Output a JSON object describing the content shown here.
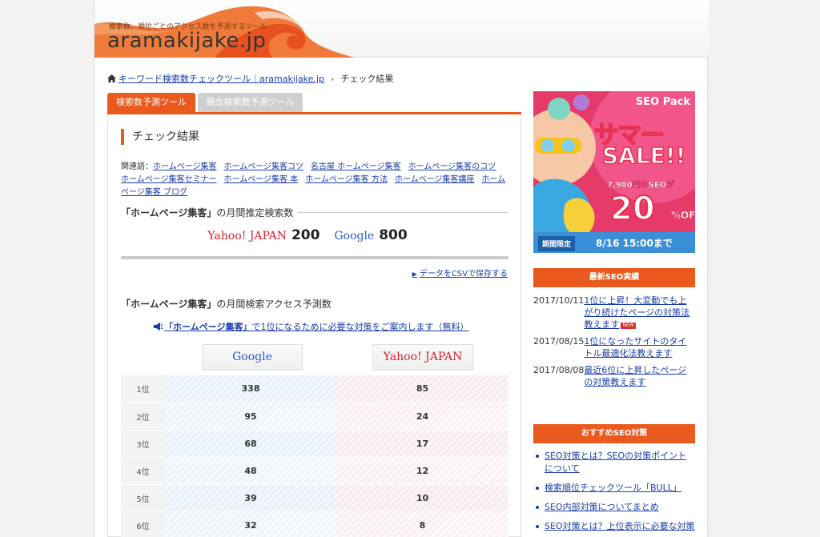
{
  "header": {
    "tagline": "検索数、順位ごとのアクセス数を予測するツール",
    "logo": "aramakijake.jp"
  },
  "breadcrumb": {
    "home_link": "キーワード検索数チェックツール｜aramakijake.jp",
    "current": "チェック結果"
  },
  "tabs": [
    {
      "label": "検索数予測ツール",
      "active": true
    },
    {
      "label": "競合検索数予測ツール",
      "active": false
    }
  ],
  "main": {
    "title": "チェック結果",
    "related_label": "関連語：",
    "related": [
      "ホームページ集客",
      "ホームページ集客コツ",
      "名古屋 ホームページ集客",
      "ホームページ集客のコツ",
      "ホームページ集客セミナー",
      "ホームページ集客 本",
      "ホームページ集客 方法",
      "ホームページ集客講座",
      "ホームページ集客 ブログ"
    ],
    "volume_heading_keyword": "「ホームページ集客」",
    "volume_heading_suffix": "の月間推定検索数",
    "yahoo_label": "Yahoo! JAPAN",
    "yahoo_volume": "200",
    "google_label": "Google",
    "google_volume": "800",
    "csv_link": "データをCSVで保存する",
    "access_heading_keyword": "「ホームページ集客」",
    "access_heading_suffix": "の月間検索アクセス予測数",
    "cta_keyword": "「ホームページ集客」",
    "cta_suffix": "で1位になるために必要な対策をご案内します（無料）",
    "col_google": "Google",
    "col_yahoo": "Yahoo! JAPAN",
    "ranks": [
      {
        "rank": "1位",
        "google": "338",
        "yahoo": "85"
      },
      {
        "rank": "2位",
        "google": "95",
        "yahoo": "24"
      },
      {
        "rank": "3位",
        "google": "68",
        "yahoo": "17"
      },
      {
        "rank": "4位",
        "google": "48",
        "yahoo": "12"
      },
      {
        "rank": "5位",
        "google": "39",
        "yahoo": "10"
      },
      {
        "rank": "6位",
        "google": "32",
        "yahoo": "8"
      }
    ]
  },
  "banner": {
    "seo_pack": "SEO Pack",
    "summer": "サマー",
    "sale": "SALE!!",
    "price": "7,980円のSEOが",
    "percent": "20",
    "off": "%OFF",
    "limited": "期間限定",
    "date": "8/16 15:00まで"
  },
  "sidebar": {
    "news_heading": "最新SEO実績",
    "news": [
      {
        "date": "2017/10/11",
        "title": "1位に上昇！大変動でも上がり続けたページの対策法教えます",
        "new_badge": "NEW"
      },
      {
        "date": "2017/08/15",
        "title": "1位になったサイトのタイトル最適化法教えます",
        "new_badge": ""
      },
      {
        "date": "2017/08/08",
        "title": "最近6位に上昇したページの対策教えます",
        "new_badge": ""
      }
    ],
    "rec_heading": "おすすめSEO対策",
    "rec": [
      "SEO対策とは？SEOの対策ポイントについて",
      "検索順位チェックツール「BULL」",
      "SEO内部対策についてまとめ",
      "SEO対策とは？上位表示に必要な対策"
    ]
  },
  "colors": {
    "accent": "#ea5a1e",
    "link": "#1a3dab",
    "yahoo_red": "#d8222e",
    "google_blue": "#2a5cc9"
  }
}
